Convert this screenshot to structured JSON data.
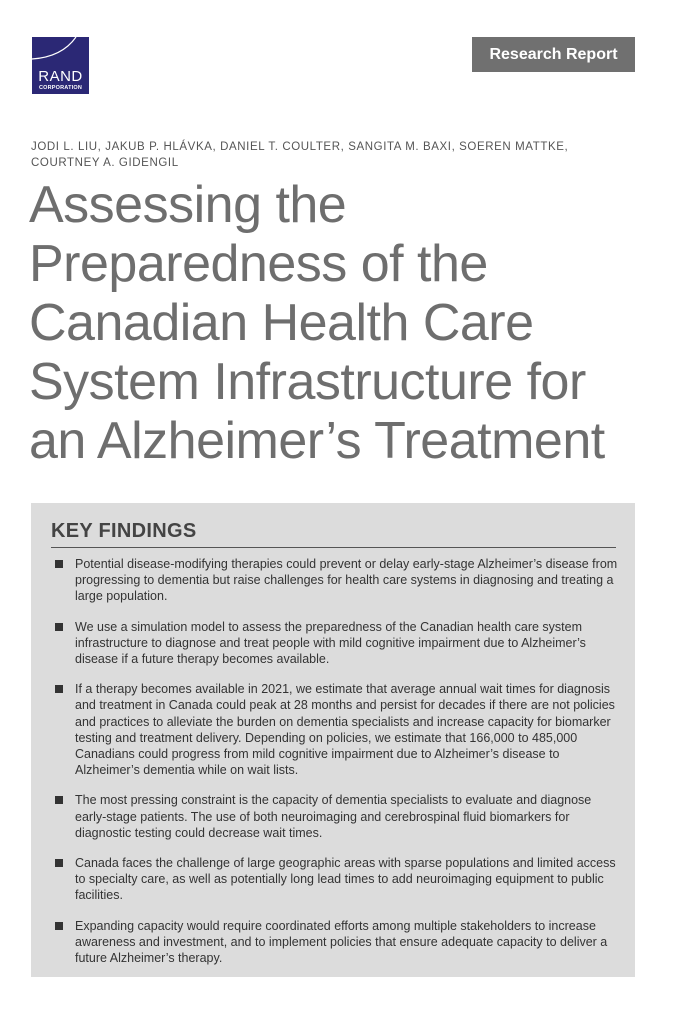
{
  "logo": {
    "name": "RAND",
    "sub": "CORPORATION"
  },
  "badge": "Research Report",
  "authors_line1": "JODI L. LIU, JAKUB P. HLÁVKA, DANIEL T. COULTER, SANGITA M. BAXI, SOEREN MATTKE,",
  "authors_line2": "COURTNEY A. GIDENGIL",
  "title_lines": [
    "Assessing the",
    "Preparedness of the",
    "Canadian Health Care",
    "System Infrastructure for",
    "an Alzheimer’s Treatment"
  ],
  "key_findings": {
    "heading": "KEY FINDINGS",
    "items": [
      "Potential disease-modifying therapies could prevent or delay early-stage Alzheimer’s disease from progressing to dementia but raise challenges for health care systems in diagnosing and treating a large population.",
      "We use a simulation model to assess the preparedness of the Canadian health care system infrastructure to diagnose and treat people with mild cognitive impairment due to Alzheimer’s disease if a future therapy becomes available.",
      "If a therapy becomes available in 2021, we estimate that average annual wait times for diagnosis and treatment in Canada could peak at 28 months and persist for decades if there are not policies and practices to alleviate the burden on dementia specialists and increase capacity for biomarker testing and treatment delivery. Depending on policies, we estimate that 166,000 to 485,000 Canadians could progress from mild cognitive impairment due to Alzheimer’s disease to Alzheimer’s dementia while on wait lists.",
      "The most pressing constraint is the capacity of dementia specialists to evaluate and diagnose early-stage patients. The use of both neuroimaging and cerebrospinal fluid biomarkers for diagnostic testing could decrease wait times.",
      "Canada faces the challenge of large geographic areas with sparse populations and limited access to specialty care, as well as potentially long lead times to add neuroimaging equipment to public facilities.",
      "Expanding capacity would require coordinated efforts among multiple stakeholders to increase awareness and investment, and to implement policies that ensure adequate capacity to deliver a future Alzheimer’s therapy."
    ]
  }
}
